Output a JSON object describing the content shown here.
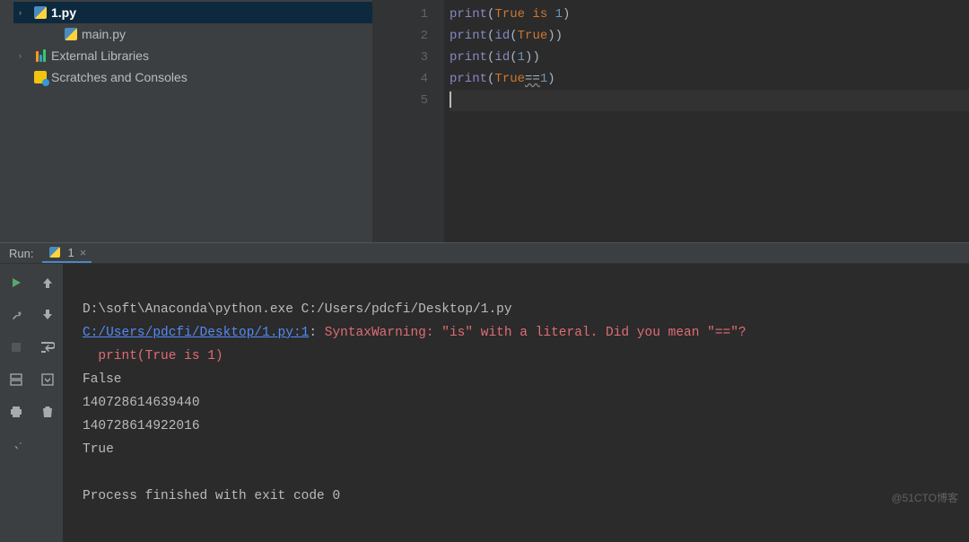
{
  "project": {
    "items": [
      {
        "label": "1.py",
        "icon": "python-file",
        "arrow": "›",
        "selected": true,
        "indent": 0
      },
      {
        "label": "main.py",
        "icon": "python-file",
        "arrow": "",
        "selected": false,
        "indent": 1
      },
      {
        "label": "External Libraries",
        "icon": "lib",
        "arrow": "›",
        "selected": false,
        "indent": 0
      },
      {
        "label": "Scratches and Consoles",
        "icon": "scratch",
        "arrow": "",
        "selected": false,
        "indent": 0
      }
    ]
  },
  "editor": {
    "line_numbers": [
      "1",
      "2",
      "3",
      "4",
      "5"
    ],
    "code": {
      "l1": {
        "fn": "print",
        "op": "(",
        "kw1": "True",
        "mid": " is ",
        "num": "1",
        "cp": ")"
      },
      "l2": {
        "fn": "print",
        "op": "(",
        "fn2": "id",
        "op2": "(",
        "kw1": "True",
        "cp2": ")",
        "cp": ")"
      },
      "l3": {
        "fn": "print",
        "op": "(",
        "fn2": "id",
        "op2": "(",
        "num": "1",
        "cp2": ")",
        "cp": ")"
      },
      "l4": {
        "fn": "print",
        "op": "(",
        "kw1": "True",
        "warn": "==",
        "num": "1",
        "cp": ")"
      }
    }
  },
  "run": {
    "label": "Run:",
    "tab": {
      "label": "1",
      "close": "×"
    }
  },
  "console": {
    "l1": "D:\\soft\\Anaconda\\python.exe C:/Users/pdcfi/Desktop/1.py",
    "l2_link": "C:/Users/pdcfi/Desktop/1.py:1",
    "l2_colon": ": ",
    "l2_warn": "SyntaxWarning: \"is\" with a literal. Did you mean \"==\"?",
    "l3": "  print(True is 1)",
    "l4": "False",
    "l5": "140728614639440",
    "l6": "140728614922016",
    "l7": "True",
    "l8": "",
    "l9": "Process finished with exit code 0"
  },
  "watermark": "@51CTO博客"
}
